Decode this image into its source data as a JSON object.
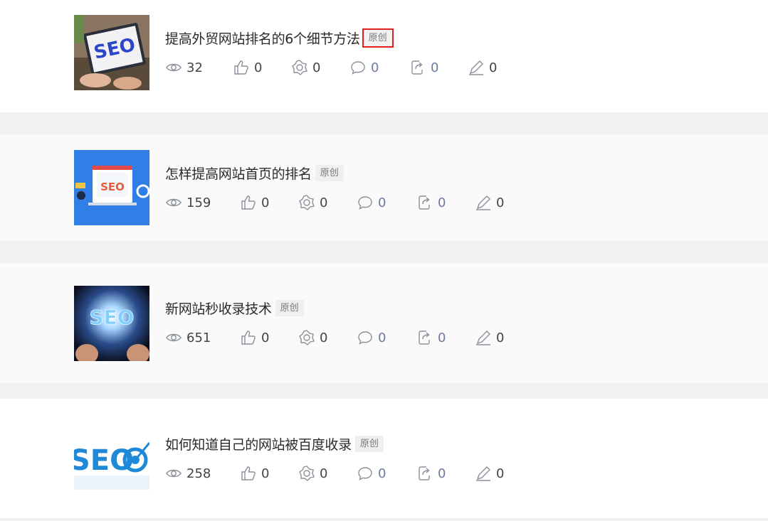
{
  "articles": [
    {
      "title": "提高外贸网站排名的6个细节方法",
      "badge": "原创",
      "thumb_text": "SEO",
      "views": "32",
      "likes": "0",
      "shares": "0",
      "comments": "0",
      "forwards": "0",
      "edits": "0"
    },
    {
      "title": "怎样提高网站首页的排名",
      "badge": "原创",
      "thumb_text": "SEO",
      "views": "159",
      "likes": "0",
      "shares": "0",
      "comments": "0",
      "forwards": "0",
      "edits": "0"
    },
    {
      "title": "新网站秒收录技术",
      "badge": "原创",
      "thumb_text": "SEO",
      "views": "651",
      "likes": "0",
      "shares": "0",
      "comments": "0",
      "forwards": "0",
      "edits": "0"
    },
    {
      "title": "如何知道自己的网站被百度收录",
      "badge": "原创",
      "thumb_text": "SEO",
      "views": "258",
      "likes": "0",
      "shares": "0",
      "comments": "0",
      "forwards": "0",
      "edits": "0"
    }
  ],
  "colors": {
    "highlight_border": "#e02020",
    "icon": "#8a8f99"
  }
}
